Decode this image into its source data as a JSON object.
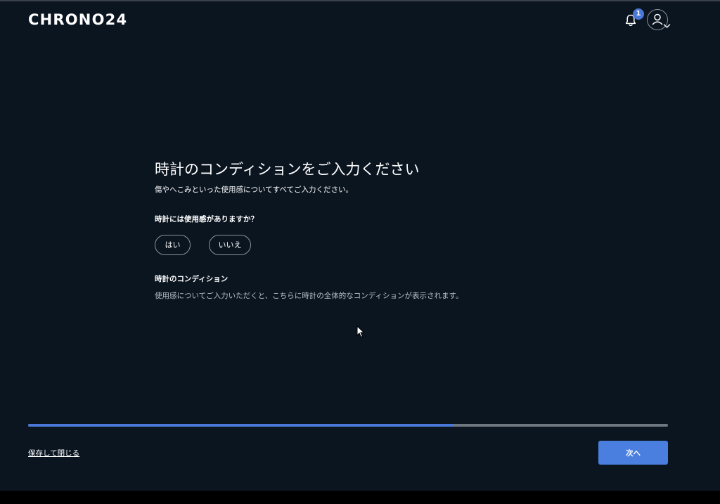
{
  "header": {
    "logo": "CHRONO24",
    "notification_count": "1",
    "icons": [
      "bell-icon",
      "user-icon",
      "chevron-down-icon"
    ]
  },
  "main": {
    "title": "時計のコンディションをご入力ください",
    "subtitle": "傷やへこみといった使用感についてすべてご入力ください。",
    "question": "時計には使用感がありますか？",
    "options": [
      {
        "label": "はい"
      },
      {
        "label": "いいえ"
      }
    ],
    "condition_label": "時計のコンディション",
    "condition_description": "使用感についてご入力いただくと、こちらに時計の全体的なコンディションが表示されます。"
  },
  "footer": {
    "progress_fraction": 0.665,
    "save_label": "保存して閉じる",
    "next_label": "次へ"
  },
  "colors": {
    "background": "#0b1520",
    "accent": "#4a78d8",
    "progress_track": "#6e7680"
  }
}
